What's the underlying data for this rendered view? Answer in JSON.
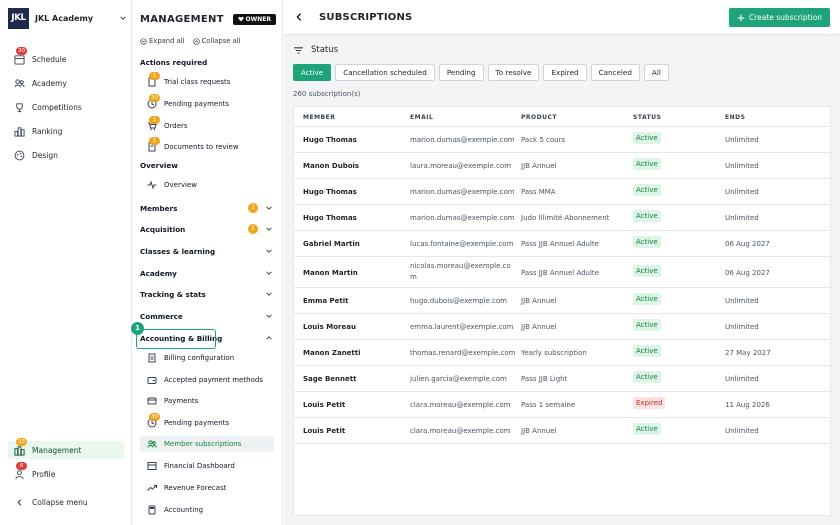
{
  "org": {
    "logo": "JKL",
    "name": "JKL Academy"
  },
  "leftnav": {
    "items": [
      {
        "label": "Schedule",
        "icon": "calendar-icon",
        "badge": "30"
      },
      {
        "label": "Academy",
        "icon": "people-icon"
      },
      {
        "label": "Competitions",
        "icon": "trophy-icon"
      },
      {
        "label": "Ranking",
        "icon": "ranking-icon"
      },
      {
        "label": "Design",
        "icon": "palette-icon"
      }
    ],
    "bottom": [
      {
        "label": "Management",
        "icon": "management-icon",
        "badge": "33"
      },
      {
        "label": "Profile",
        "icon": "user-icon",
        "badge": "6"
      }
    ],
    "collapse": "Collapse menu"
  },
  "mid": {
    "title": "MANAGEMENT",
    "owner": "OWNER",
    "expand_all": "Expand all",
    "collapse_all": "Collapse all",
    "actions_title": "Actions required",
    "actions": [
      {
        "label": "Trial class requests",
        "badge": "1"
      },
      {
        "label": "Pending payments",
        "badge": "30"
      },
      {
        "label": "Orders",
        "badge": "1"
      },
      {
        "label": "Documents to review",
        "badge": "1"
      }
    ],
    "overview_title": "Overview",
    "overview_item": "Overview",
    "groups": [
      {
        "label": "Members",
        "badge": "1"
      },
      {
        "label": "Acquisition",
        "badge": "1"
      },
      {
        "label": "Classes & learning"
      },
      {
        "label": "Academy"
      },
      {
        "label": "Tracking & stats"
      },
      {
        "label": "Commerce"
      },
      {
        "label": "Accounting & Billing"
      }
    ],
    "highlight_number": "1",
    "billing_items": [
      {
        "label": "Billing configuration",
        "icon": "document-icon"
      },
      {
        "label": "Accepted payment methods",
        "icon": "wallet-icon"
      },
      {
        "label": "Payments",
        "icon": "card-icon"
      },
      {
        "label": "Pending payments",
        "icon": "clock-icon",
        "badge": "30"
      },
      {
        "label": "Member subscriptions",
        "icon": "members-icon"
      },
      {
        "label": "Financial Dashboard",
        "icon": "dashboard-icon"
      },
      {
        "label": "Revenue Forecast",
        "icon": "trend-icon"
      },
      {
        "label": "Accounting",
        "icon": "calculator-icon"
      }
    ]
  },
  "main": {
    "title": "SUBSCRIPTIONS",
    "create_button": "Create subscription",
    "status_label": "Status",
    "filters": [
      "Active",
      "Cancellation scheduled",
      "Pending",
      "To resolve",
      "Expired",
      "Canceled",
      "All"
    ],
    "count": "260 subscription(s)",
    "columns": [
      "MEMBER",
      "EMAIL",
      "PRODUCT",
      "STATUS",
      "ENDS"
    ],
    "rows": [
      {
        "member": "Hugo Thomas",
        "email": "marion.dumas@exemple.com",
        "product": "Pack 5 cours",
        "status": "Active",
        "ends": "Unlimited"
      },
      {
        "member": "Manon Dubois",
        "email": "laura.moreau@exemple.com",
        "product": "JJB Annuel",
        "status": "Active",
        "ends": "Unlimited"
      },
      {
        "member": "Hugo Thomas",
        "email": "marion.dumas@exemple.com",
        "product": "Pass MMA",
        "status": "Active",
        "ends": "Unlimited"
      },
      {
        "member": "Hugo Thomas",
        "email": "marion.dumas@exemple.com",
        "product": "Judo Illimité Abonnement",
        "status": "Active",
        "ends": "Unlimited"
      },
      {
        "member": "Gabriel Martin",
        "email": "lucas.fontaine@exemple.com",
        "product": "Pass JJB Annuel Adulte",
        "status": "Active",
        "ends": "06 Aug 2027"
      },
      {
        "member": "Manon Martin",
        "email": "nicolas.moreau@exemple.co",
        "email2": "m",
        "product": "Pass JJB Annuel Adulte",
        "status": "Active",
        "ends": "06 Aug 2027"
      },
      {
        "member": "Emma Petit",
        "email": "hugo.dubois@exemple.com",
        "product": "JJB Annuel",
        "status": "Active",
        "ends": "Unlimited"
      },
      {
        "member": "Louis Moreau",
        "email": "emma.laurent@exemple.com",
        "product": "JJB Annuel",
        "status": "Active",
        "ends": "Unlimited"
      },
      {
        "member": "Manon Zanetti",
        "email": "thomas.renard@exemple.com",
        "product": "Yearly subscription",
        "status": "Active",
        "ends": "27 May 2027"
      },
      {
        "member": "Sage Bennett",
        "email": "julien.garcia@exemple.com",
        "product": "Pass JJB Light",
        "status": "Active",
        "ends": "Unlimited"
      },
      {
        "member": "Louis Petit",
        "email": "clara.moreau@exemple.com",
        "product": "Pass 1 semaine",
        "status": "Expired",
        "ends": "11 Aug 2026"
      },
      {
        "member": "Louis Petit",
        "email": "clara.moreau@exemple.com",
        "product": "JJB Annuel",
        "status": "Active",
        "ends": "Unlimited"
      }
    ]
  },
  "colors": {
    "accent": "#1fa37a",
    "active_bg": "#dcf5e6",
    "expired_bg": "#fde2e2",
    "badge_red": "#e23b3b",
    "badge_orange": "#f0a41e"
  }
}
